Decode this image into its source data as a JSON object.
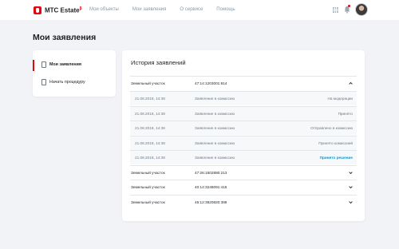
{
  "header": {
    "logo_text": "МТС Estate",
    "logo_sup": "β",
    "nav": [
      "Мои объекты",
      "Мои заявления",
      "О сервисе",
      "Помощь"
    ],
    "colors": {
      "brand": "#e30611",
      "accent": "#0a98d8"
    }
  },
  "page": {
    "title": "Мои заявления"
  },
  "sidebar": {
    "items": [
      {
        "label": "Мои заявления",
        "icon": "document-icon",
        "active": true
      },
      {
        "label": "Начать процедуру",
        "icon": "document-icon",
        "active": false
      }
    ]
  },
  "history": {
    "title": "История заявлений",
    "groups": [
      {
        "type": "Земельный участок",
        "number": "47:14:1203001:814",
        "expanded": true,
        "entries": [
          {
            "date": "21.08.2018, 14:38",
            "event": "Заявление в комиссию",
            "status": "На модерации"
          },
          {
            "date": "21.08.2018, 14:38",
            "event": "Заявление в комиссию",
            "status": "Принято"
          },
          {
            "date": "21.08.2018, 14:38",
            "event": "Заявление в комиссию",
            "status": "Отправлено в комиссию"
          },
          {
            "date": "21.08.2018, 14:38",
            "event": "Заявление в комиссию",
            "status": "Принято комиссией"
          },
          {
            "date": "21.08.2018, 14:38",
            "event": "Заявление в комиссию",
            "status": "Принято решение"
          }
        ]
      },
      {
        "type": "Земельный участок",
        "number": "47:26:1502880:213",
        "expanded": false
      },
      {
        "type": "Земельный участок",
        "number": "40:14:3248091:415",
        "expanded": false
      },
      {
        "type": "Земельный участок",
        "number": "45:12:3820820:389",
        "expanded": false
      }
    ]
  }
}
